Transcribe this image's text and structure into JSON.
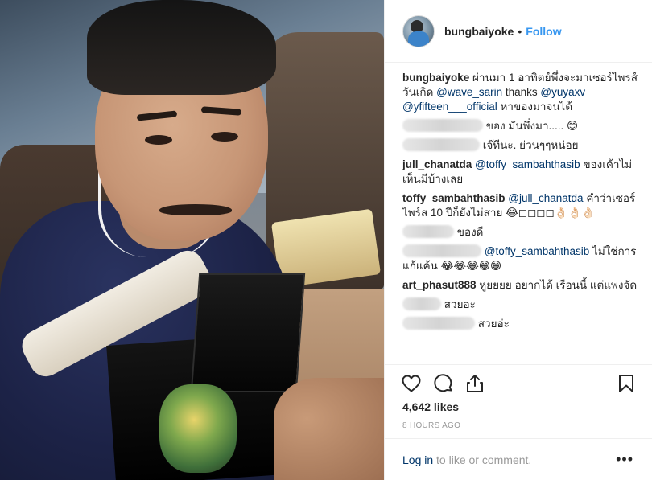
{
  "post": {
    "username": "bungbaiyoke",
    "separator": "•",
    "follow_label": "Follow"
  },
  "comments": [
    {
      "parts": [
        {
          "t": "user",
          "v": "bungbaiyoke"
        },
        {
          "t": "text",
          "v": " ผ่านมา 1 อาทิตย์พึ่งจะมาเซอร์ไพรส์วันเกิด "
        },
        {
          "t": "mention",
          "v": "@wave_sarin"
        },
        {
          "t": "text",
          "v": " thanks "
        },
        {
          "t": "mention",
          "v": "@yuyaxv"
        },
        {
          "t": "text",
          "v": " "
        },
        {
          "t": "mention",
          "v": "@yfifteen___official"
        },
        {
          "t": "text",
          "v": " หาของมาจนได้"
        }
      ]
    },
    {
      "parts": [
        {
          "t": "blur",
          "w": 100
        },
        {
          "t": "text",
          "v": " ของ มันพึ่งมา..... 😊"
        }
      ]
    },
    {
      "parts": [
        {
          "t": "blur",
          "w": 96
        },
        {
          "t": "text",
          "v": " เจ๊ทีนะ. ย่วนๆๆหน่อย"
        }
      ]
    },
    {
      "parts": [
        {
          "t": "user",
          "v": "jull_chanatda"
        },
        {
          "t": "text",
          "v": " "
        },
        {
          "t": "mention",
          "v": "@toffy_sambahthasib"
        },
        {
          "t": "text",
          "v": " ของเค้าไม่เห็นมีบ้างเลย"
        }
      ]
    },
    {
      "parts": [
        {
          "t": "user",
          "v": "toffy_sambahthasib"
        },
        {
          "t": "text",
          "v": " "
        },
        {
          "t": "mention",
          "v": "@jull_chanatda"
        },
        {
          "t": "text",
          "v": " คำว่าเซอร์ไพร์ส 10 ปีก็ยังไม่สาย 😂◻◻◻◻👌🏻👌🏻👌🏻"
        }
      ]
    },
    {
      "parts": [
        {
          "t": "blur",
          "w": 64
        },
        {
          "t": "text",
          "v": " ของดี"
        }
      ]
    },
    {
      "parts": [
        {
          "t": "blur",
          "w": 98
        },
        {
          "t": "text",
          "v": " "
        },
        {
          "t": "mention",
          "v": "@toffy_sambahthasib"
        },
        {
          "t": "text",
          "v": " ไม่ใช่การแก้แค้น 😂😂😂😁😁"
        }
      ]
    },
    {
      "parts": [
        {
          "t": "user",
          "v": "art_phasut888"
        },
        {
          "t": "text",
          "v": " หูยยยย อยากได้ เรือนนี้ แต่แพงจัด"
        }
      ]
    },
    {
      "parts": [
        {
          "t": "blur",
          "w": 48
        },
        {
          "t": "text",
          "v": " สวยอะ"
        }
      ]
    },
    {
      "parts": [
        {
          "t": "blur",
          "w": 90
        },
        {
          "t": "text",
          "v": " สวยอ่ะ"
        }
      ]
    }
  ],
  "actions": {
    "icons": [
      "heart-icon",
      "comment-icon",
      "share-icon",
      "bookmark-icon"
    ]
  },
  "likes_text": "4,642 likes",
  "time_text": "8 HOURS AGO",
  "footer": {
    "login_link": "Log in",
    "login_rest": " to like or comment.",
    "more_label": "•••"
  }
}
